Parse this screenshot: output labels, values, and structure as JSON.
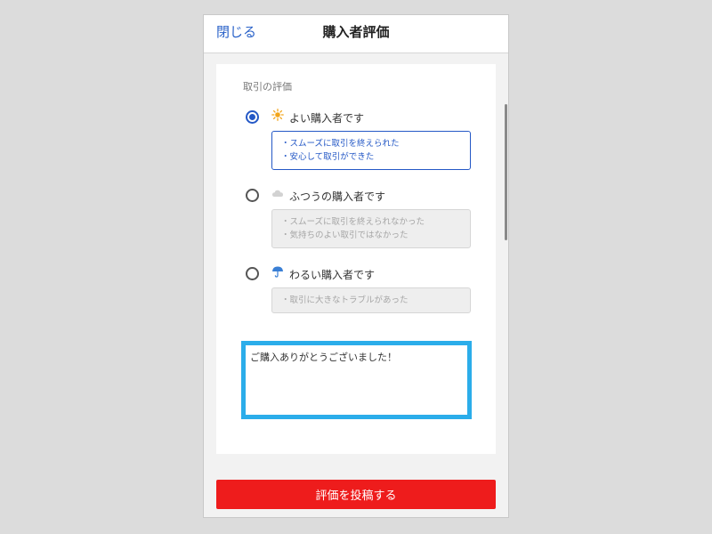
{
  "header": {
    "close_label": "閉じる",
    "title": "購入者評価"
  },
  "rating": {
    "section_label": "取引の評価",
    "options": [
      {
        "label": "よい購入者です",
        "icon": "sun-icon",
        "selected": true,
        "descriptions": [
          "・スムーズに取引を終えられた",
          "・安心して取引ができた"
        ]
      },
      {
        "label": "ふつうの購入者です",
        "icon": "cloud-icon",
        "selected": false,
        "descriptions": [
          "・スムーズに取引を終えられなかった",
          "・気持ちのよい取引ではなかった"
        ]
      },
      {
        "label": "わるい購入者です",
        "icon": "umbrella-icon",
        "selected": false,
        "descriptions": [
          "・取引に大きなトラブルがあった"
        ]
      }
    ]
  },
  "comment": {
    "value": "ご購入ありがとうございました！"
  },
  "submit": {
    "label": "評価を投稿する"
  },
  "colors": {
    "accent_blue": "#2458c6",
    "submit_red": "#ee1c1c",
    "highlight_border": "#2badea"
  }
}
